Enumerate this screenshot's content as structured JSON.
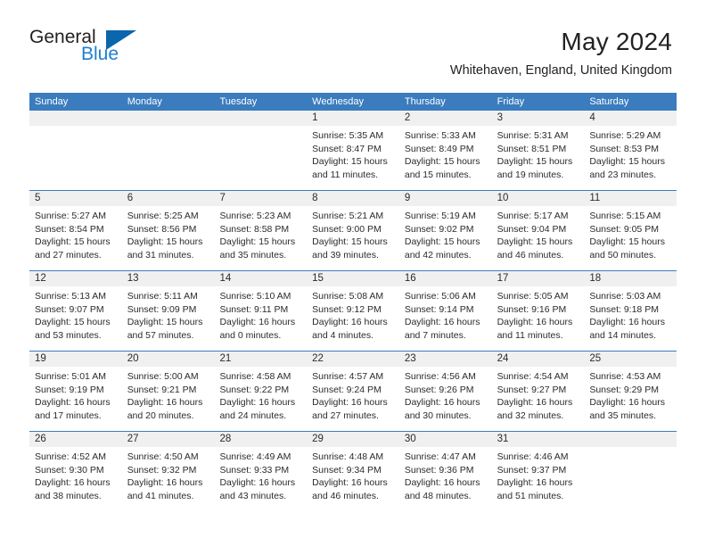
{
  "brand": {
    "name_part1": "General",
    "name_part2": "Blue",
    "colors": {
      "dark": "#231f20",
      "blue": "#1c7fd1",
      "triangle": "#0a66ad"
    }
  },
  "header": {
    "month_title": "May 2024",
    "location": "Whitehaven, England, United Kingdom"
  },
  "calendar": {
    "header_bg": "#3a7cbe",
    "weekdays": [
      "Sunday",
      "Monday",
      "Tuesday",
      "Wednesday",
      "Thursday",
      "Friday",
      "Saturday"
    ],
    "weeks": [
      {
        "days": [
          {
            "num": "",
            "lines": []
          },
          {
            "num": "",
            "lines": []
          },
          {
            "num": "",
            "lines": []
          },
          {
            "num": "1",
            "lines": [
              "Sunrise: 5:35 AM",
              "Sunset: 8:47 PM",
              "Daylight: 15 hours",
              "and 11 minutes."
            ]
          },
          {
            "num": "2",
            "lines": [
              "Sunrise: 5:33 AM",
              "Sunset: 8:49 PM",
              "Daylight: 15 hours",
              "and 15 minutes."
            ]
          },
          {
            "num": "3",
            "lines": [
              "Sunrise: 5:31 AM",
              "Sunset: 8:51 PM",
              "Daylight: 15 hours",
              "and 19 minutes."
            ]
          },
          {
            "num": "4",
            "lines": [
              "Sunrise: 5:29 AM",
              "Sunset: 8:53 PM",
              "Daylight: 15 hours",
              "and 23 minutes."
            ]
          }
        ]
      },
      {
        "days": [
          {
            "num": "5",
            "lines": [
              "Sunrise: 5:27 AM",
              "Sunset: 8:54 PM",
              "Daylight: 15 hours",
              "and 27 minutes."
            ]
          },
          {
            "num": "6",
            "lines": [
              "Sunrise: 5:25 AM",
              "Sunset: 8:56 PM",
              "Daylight: 15 hours",
              "and 31 minutes."
            ]
          },
          {
            "num": "7",
            "lines": [
              "Sunrise: 5:23 AM",
              "Sunset: 8:58 PM",
              "Daylight: 15 hours",
              "and 35 minutes."
            ]
          },
          {
            "num": "8",
            "lines": [
              "Sunrise: 5:21 AM",
              "Sunset: 9:00 PM",
              "Daylight: 15 hours",
              "and 39 minutes."
            ]
          },
          {
            "num": "9",
            "lines": [
              "Sunrise: 5:19 AM",
              "Sunset: 9:02 PM",
              "Daylight: 15 hours",
              "and 42 minutes."
            ]
          },
          {
            "num": "10",
            "lines": [
              "Sunrise: 5:17 AM",
              "Sunset: 9:04 PM",
              "Daylight: 15 hours",
              "and 46 minutes."
            ]
          },
          {
            "num": "11",
            "lines": [
              "Sunrise: 5:15 AM",
              "Sunset: 9:05 PM",
              "Daylight: 15 hours",
              "and 50 minutes."
            ]
          }
        ]
      },
      {
        "days": [
          {
            "num": "12",
            "lines": [
              "Sunrise: 5:13 AM",
              "Sunset: 9:07 PM",
              "Daylight: 15 hours",
              "and 53 minutes."
            ]
          },
          {
            "num": "13",
            "lines": [
              "Sunrise: 5:11 AM",
              "Sunset: 9:09 PM",
              "Daylight: 15 hours",
              "and 57 minutes."
            ]
          },
          {
            "num": "14",
            "lines": [
              "Sunrise: 5:10 AM",
              "Sunset: 9:11 PM",
              "Daylight: 16 hours",
              "and 0 minutes."
            ]
          },
          {
            "num": "15",
            "lines": [
              "Sunrise: 5:08 AM",
              "Sunset: 9:12 PM",
              "Daylight: 16 hours",
              "and 4 minutes."
            ]
          },
          {
            "num": "16",
            "lines": [
              "Sunrise: 5:06 AM",
              "Sunset: 9:14 PM",
              "Daylight: 16 hours",
              "and 7 minutes."
            ]
          },
          {
            "num": "17",
            "lines": [
              "Sunrise: 5:05 AM",
              "Sunset: 9:16 PM",
              "Daylight: 16 hours",
              "and 11 minutes."
            ]
          },
          {
            "num": "18",
            "lines": [
              "Sunrise: 5:03 AM",
              "Sunset: 9:18 PM",
              "Daylight: 16 hours",
              "and 14 minutes."
            ]
          }
        ]
      },
      {
        "days": [
          {
            "num": "19",
            "lines": [
              "Sunrise: 5:01 AM",
              "Sunset: 9:19 PM",
              "Daylight: 16 hours",
              "and 17 minutes."
            ]
          },
          {
            "num": "20",
            "lines": [
              "Sunrise: 5:00 AM",
              "Sunset: 9:21 PM",
              "Daylight: 16 hours",
              "and 20 minutes."
            ]
          },
          {
            "num": "21",
            "lines": [
              "Sunrise: 4:58 AM",
              "Sunset: 9:22 PM",
              "Daylight: 16 hours",
              "and 24 minutes."
            ]
          },
          {
            "num": "22",
            "lines": [
              "Sunrise: 4:57 AM",
              "Sunset: 9:24 PM",
              "Daylight: 16 hours",
              "and 27 minutes."
            ]
          },
          {
            "num": "23",
            "lines": [
              "Sunrise: 4:56 AM",
              "Sunset: 9:26 PM",
              "Daylight: 16 hours",
              "and 30 minutes."
            ]
          },
          {
            "num": "24",
            "lines": [
              "Sunrise: 4:54 AM",
              "Sunset: 9:27 PM",
              "Daylight: 16 hours",
              "and 32 minutes."
            ]
          },
          {
            "num": "25",
            "lines": [
              "Sunrise: 4:53 AM",
              "Sunset: 9:29 PM",
              "Daylight: 16 hours",
              "and 35 minutes."
            ]
          }
        ]
      },
      {
        "days": [
          {
            "num": "26",
            "lines": [
              "Sunrise: 4:52 AM",
              "Sunset: 9:30 PM",
              "Daylight: 16 hours",
              "and 38 minutes."
            ]
          },
          {
            "num": "27",
            "lines": [
              "Sunrise: 4:50 AM",
              "Sunset: 9:32 PM",
              "Daylight: 16 hours",
              "and 41 minutes."
            ]
          },
          {
            "num": "28",
            "lines": [
              "Sunrise: 4:49 AM",
              "Sunset: 9:33 PM",
              "Daylight: 16 hours",
              "and 43 minutes."
            ]
          },
          {
            "num": "29",
            "lines": [
              "Sunrise: 4:48 AM",
              "Sunset: 9:34 PM",
              "Daylight: 16 hours",
              "and 46 minutes."
            ]
          },
          {
            "num": "30",
            "lines": [
              "Sunrise: 4:47 AM",
              "Sunset: 9:36 PM",
              "Daylight: 16 hours",
              "and 48 minutes."
            ]
          },
          {
            "num": "31",
            "lines": [
              "Sunrise: 4:46 AM",
              "Sunset: 9:37 PM",
              "Daylight: 16 hours",
              "and 51 minutes."
            ]
          },
          {
            "num": "",
            "lines": []
          }
        ]
      }
    ]
  }
}
